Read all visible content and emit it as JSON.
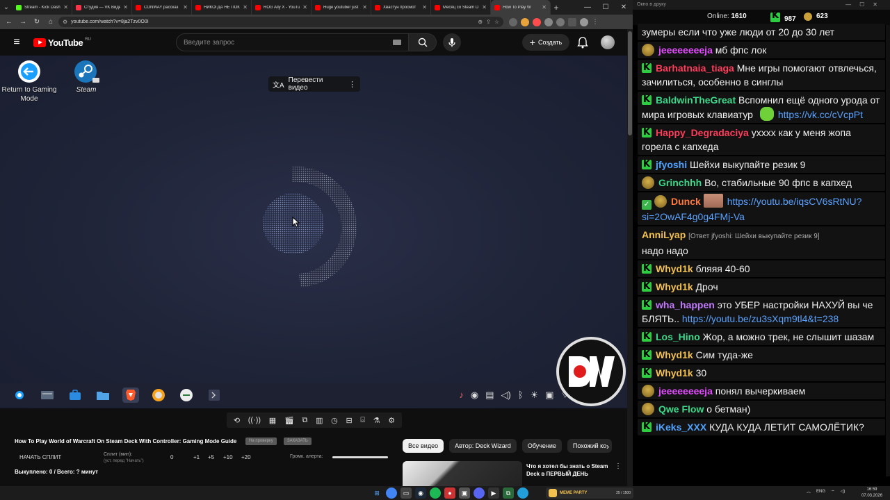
{
  "browser": {
    "tabs": [
      {
        "label": "Stream - Kick Dash",
        "color": "#53fc18"
      },
      {
        "label": "Студия — VK Видео",
        "color": "#ff3347"
      },
      {
        "label": "CONWAY рассказ",
        "color": "#ff0000"
      },
      {
        "label": "НИКОГДА НЕ ПОК",
        "color": "#ff0000"
      },
      {
        "label": "ROG Ally X - YouTu",
        "color": "#ff0000"
      },
      {
        "label": "Huge youtuber just",
        "color": "#ff0000"
      },
      {
        "label": "Хвастун просмот",
        "color": "#ff0000"
      },
      {
        "label": "Месяц со Steam D",
        "color": "#ff0000"
      },
      {
        "label": "How To Play W",
        "color": "#ff0000",
        "active": true
      }
    ],
    "url": "youtube.com/watch?v=8ja2Tzv0O0I"
  },
  "youtube": {
    "logo_text": "YouTube",
    "logo_country": "RU",
    "search_placeholder": "Введите запрос",
    "create_label": "Создать"
  },
  "video": {
    "desktop_icons": [
      {
        "label": "Return to Gaming Mode",
        "icon": "return-arrow-icon"
      },
      {
        "label": "Steam",
        "icon": "steam-icon"
      }
    ],
    "translate_label": "Перевести видео"
  },
  "below": {
    "title": "How To Play World of Warcraft On Steam Deck With Controller: Gaming Mode Guide",
    "badge1": "На проверку",
    "badge2": "ЗАКАЗАТЬ",
    "split_start": "НАЧАТЬ СПЛИТ",
    "split_min_label": "Сплит (мин):",
    "split_min_hint": "(уст. перед \"Начать\")",
    "split_values": [
      "0",
      "+1",
      "+5",
      "+10",
      "+20"
    ],
    "alert_volume_label": "Громк. алерта:",
    "alert_volume_level": 1.0,
    "bought": "Выкуплено: 0 / Всего: ? минут",
    "chips": [
      "Все видео",
      "Автор: Deck Wizard",
      "Обучение",
      "Похожий ко"
    ],
    "rec_title": "Что я хотел бы знать о Steam Deck в ПЕРВЫЙ ДЕНЬ"
  },
  "chat": {
    "window_title": "Окно в друку",
    "online_label": "Online:",
    "online_count": "1610",
    "viewers_k": "987",
    "viewers_other": "623",
    "messages": [
      {
        "badge": "none",
        "nick": "",
        "color": "#fff",
        "text": "зумеры если что уже люди от 20 до 30 лет"
      },
      {
        "badge": "emote",
        "nick": "jeeeeeeeeja",
        "color": "#e34bff",
        "text": "мб фпс лок"
      },
      {
        "badge": "k",
        "nick": "Barhatnaia_tiaga",
        "color": "#ff3d5a",
        "text": "Мне игры помогают отвлечься, зачилиться, особенно в синглы"
      },
      {
        "badge": "k",
        "nick": "BaldwinTheGreat",
        "color": "#3dd98b",
        "text": "Вспомнил ещё одного урода от мира игровых клавиатур",
        "link": "https://vk.cc/cVcpPt"
      },
      {
        "badge": "k",
        "nick": "Happy_Degradaciya",
        "color": "#ff3d5a",
        "text": "ухххх как у меня жопа горела с капхеда"
      },
      {
        "badge": "k",
        "nick": "jfyoshi",
        "color": "#4fa3ff",
        "text": "Шейхи выкупайте резик 9"
      },
      {
        "badge": "emote",
        "nick": "Grinchhh",
        "color": "#3dd98b",
        "text": "Во, стабильные 90 фпс в капхед"
      },
      {
        "badge": "mod",
        "nick": "Dunck",
        "color": "#ff7a3d",
        "text": "",
        "link": "https://youtu.be/iqsCV6sRtNU?si=2OwAF4g0g4FMj-Va"
      },
      {
        "badge": "none",
        "nick": "AnniLyap",
        "color": "#f2c14e",
        "reply": "[Ответ jfyoshi: Шейхи выкупайте резик 9]",
        "text": "надо надо"
      },
      {
        "badge": "k",
        "nick": "Whyd1k",
        "color": "#f2c14e",
        "text": "бляяя 40-60"
      },
      {
        "badge": "k",
        "nick": "Whyd1k",
        "color": "#f2c14e",
        "text": "Дроч"
      },
      {
        "badge": "k",
        "nick": "wha_happen",
        "color": "#c27bff",
        "text": "это УБЕР настройки НАХУЙ вы че БЛЯТЬ..",
        "link": "https://youtu.be/zu3sXqm9tl4&t=238"
      },
      {
        "badge": "k",
        "nick": "Los_Hino",
        "color": "#3dd98b",
        "text": "Жор, а можно трек, не слышит шазам"
      },
      {
        "badge": "k",
        "nick": "Whyd1k",
        "color": "#f2c14e",
        "text": "Сим туда-же"
      },
      {
        "badge": "k",
        "nick": "Whyd1k",
        "color": "#f2c14e",
        "text": "30"
      },
      {
        "badge": "emote",
        "nick": "jeeeeeeeeja",
        "color": "#e34bff",
        "text": "понял вычеркиваем"
      },
      {
        "badge": "emote",
        "nick": "Qwe Flow",
        "color": "#3dd98b",
        "text": "о бетман)"
      },
      {
        "badge": "k",
        "nick": "iKeks_XXX",
        "color": "#4fa3ff",
        "text": "КУДА КУДА ЛЕТИТ САМОЛЁТИК?"
      }
    ]
  },
  "taskbar": {
    "media_title": "MEME PARTY",
    "media_count": "25 / 1500",
    "lang": "ENG",
    "time": "16:59",
    "date": "07.03.2026"
  }
}
